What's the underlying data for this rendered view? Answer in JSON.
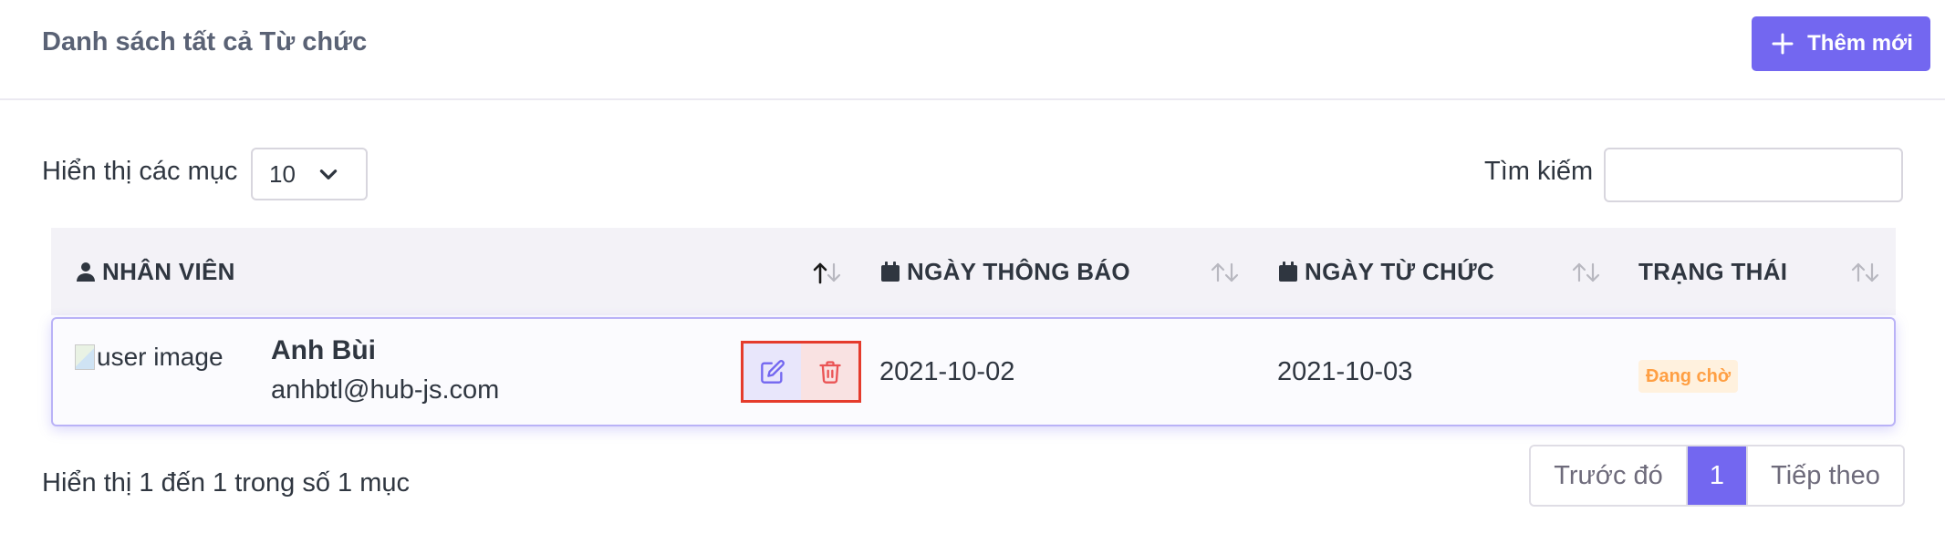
{
  "header": {
    "title": "Danh sách tất cả Từ chức",
    "add_button": "Thêm mới"
  },
  "controls": {
    "show_label": "Hiển thị các mục",
    "page_size": "10",
    "search_label": "Tìm kiếm",
    "search_value": ""
  },
  "table": {
    "columns": [
      "NHÂN VIÊN",
      "NGÀY THÔNG BÁO",
      "NGÀY TỪ CHỨC",
      "TRẠNG THÁI"
    ],
    "rows": [
      {
        "avatar_alt": "user image",
        "name": "Anh Bùi",
        "email": "anhbtl@hub-js.com",
        "notice_date": "2021-10-02",
        "resign_date": "2021-10-03",
        "status": "Đang chờ"
      }
    ]
  },
  "footer": {
    "info": "Hiển thị 1 đến 1 trong số 1 mục",
    "prev": "Trước đó",
    "current_page": "1",
    "next": "Tiếp theo"
  },
  "colors": {
    "primary": "#7367f0",
    "danger": "#ea5455",
    "warning": "#ff9f43"
  }
}
